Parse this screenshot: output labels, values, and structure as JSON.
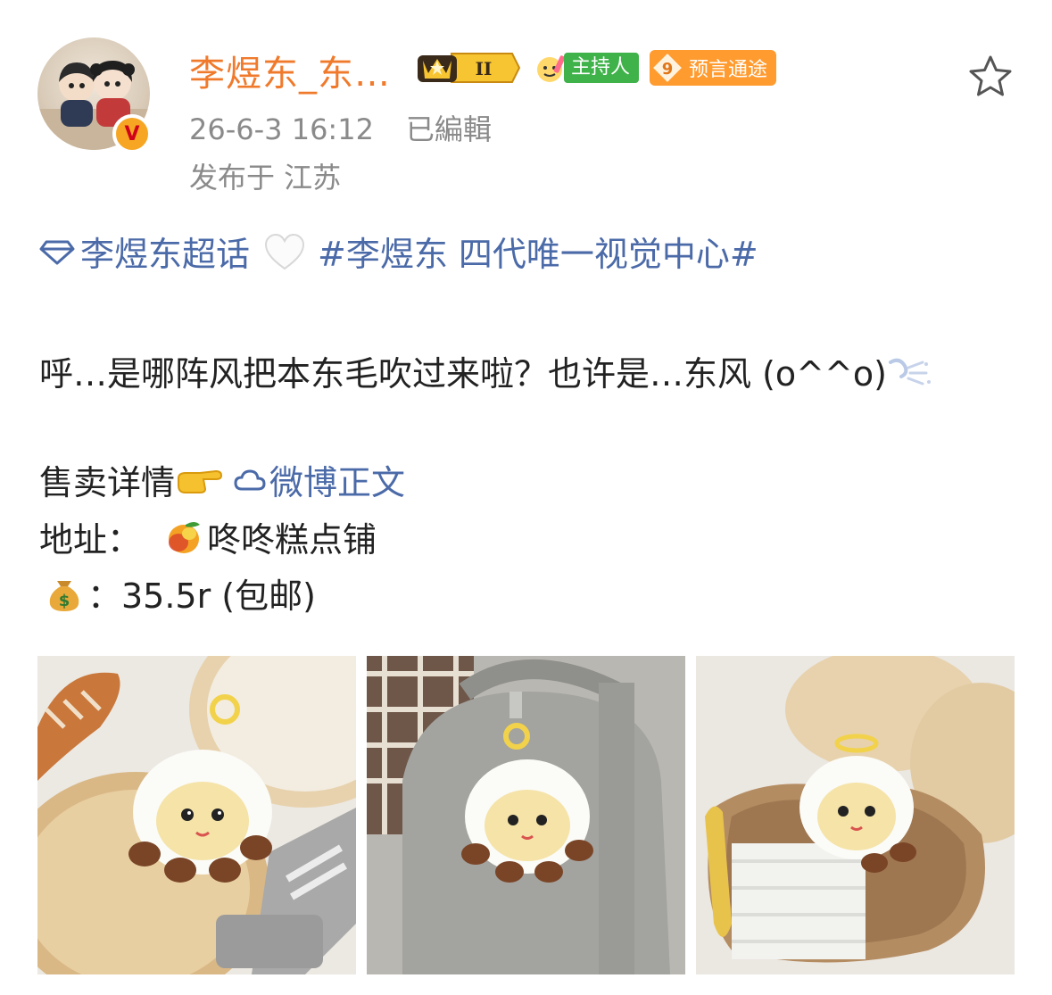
{
  "post": {
    "username": "李煜东_东…",
    "level_badge": "II",
    "host_badge": "主持人",
    "prophet_badge_num": "9",
    "prophet_badge": "预言通途",
    "verified_mark": "V",
    "timestamp": "26-6-3 16:12",
    "edited": "已編輯",
    "location": "发布于 江苏",
    "supertopic": "李煜东超话",
    "hashtag": "#李煜东 四代唯一视觉中心#",
    "line1": "呼…是哪阵风把本东毛吹过来啦？也许是…东风 (o^^o)",
    "sale_label": "售卖详情",
    "sale_link": "微博正文",
    "address_label": "地址：",
    "address_value": "咚咚糕点铺",
    "price": "：35.5r (包邮)"
  },
  "icons": {
    "favorite": "star-outline-icon",
    "supertopic": "diamond-icon",
    "heart": "white-heart-emoji",
    "wind": "wind-emoji",
    "point": "pointing-hand-emoji",
    "cloud": "cloud-icon",
    "mango": "mango-emoji",
    "money": "money-bag-emoji"
  },
  "colors": {
    "username": "#f07a2c",
    "link": "#4b6aa8",
    "meta": "#8a8a8a",
    "host_badge": "#3fb24a",
    "prophet_badge": "#ff9b2f"
  }
}
